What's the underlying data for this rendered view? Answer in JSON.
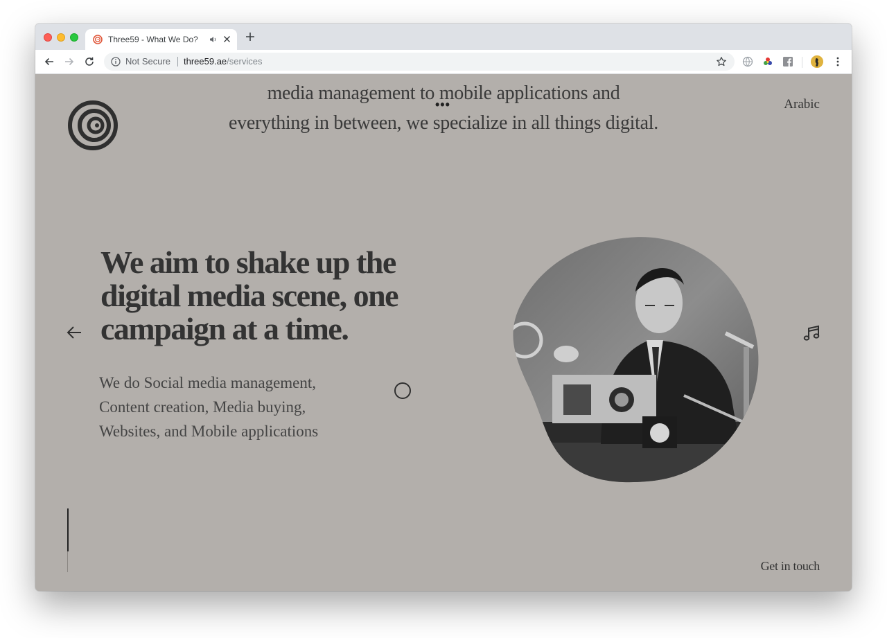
{
  "browser": {
    "tab": {
      "title": "Three59 - What We Do?"
    },
    "address": {
      "security_label": "Not Secure",
      "domain": "three59.ae",
      "path": "/services"
    }
  },
  "page": {
    "intro_line_1": "media management to mobile applications and",
    "intro_line_2": "everything in between, we specialize in all things digital.",
    "intro_ellipsis": "•••",
    "language_link": "Arabic",
    "headline": "We aim to shake up the digital media scene, one campaign at a time.",
    "services_text": "We do Social media management, Content creation, Media buying, Websites, and Mobile applications",
    "contact_link": "Get in touch"
  },
  "colors": {
    "page_background": "#b3afab",
    "text_dark": "#333333",
    "tab_strip": "#dee1e6"
  },
  "icons": [
    "info-icon",
    "star-icon",
    "back-arrow-icon",
    "forward-arrow-icon",
    "reload-icon",
    "music-note-icon",
    "arrow-left-icon",
    "spiral-logo"
  ]
}
